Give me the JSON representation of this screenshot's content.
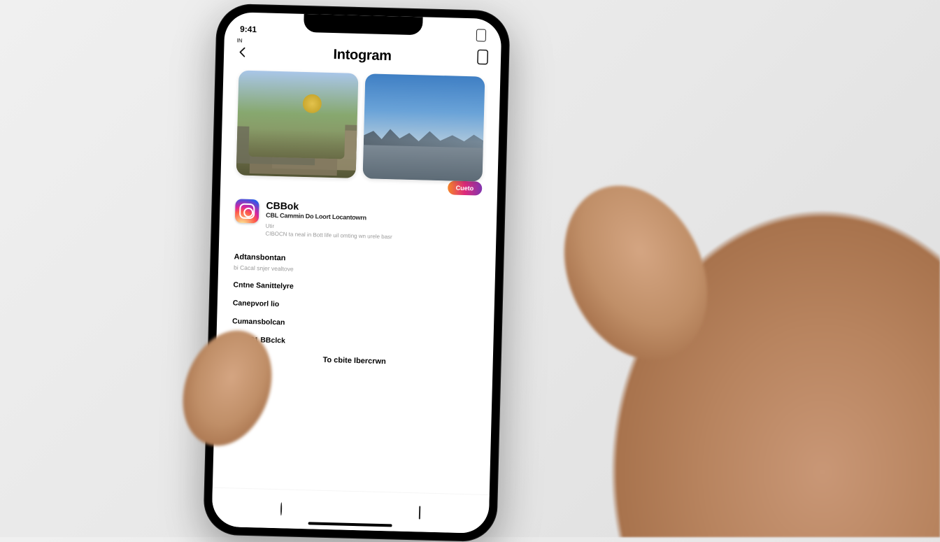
{
  "status": {
    "time": "9:41"
  },
  "header": {
    "title": "Intogram",
    "small_label": "IN"
  },
  "pill": {
    "label": "Cueto"
  },
  "profile": {
    "name": "CBBok",
    "subtitle": "CBL Cammin Do Loort Locantowrn",
    "meta1": "Utir",
    "meta2": "CIBOCN ta neal in Bott life uil omting wn urele basr"
  },
  "list": {
    "section1": {
      "heading": "Adtansbontan",
      "sub": "bi Cacal snjer vealtove"
    },
    "items": [
      "Cntne Sanittelyre",
      "Canepvorl lio",
      "Cumansbolcan",
      "Cdta 81 BBclck"
    ],
    "center_link": "To cbite Ibercrwn"
  }
}
